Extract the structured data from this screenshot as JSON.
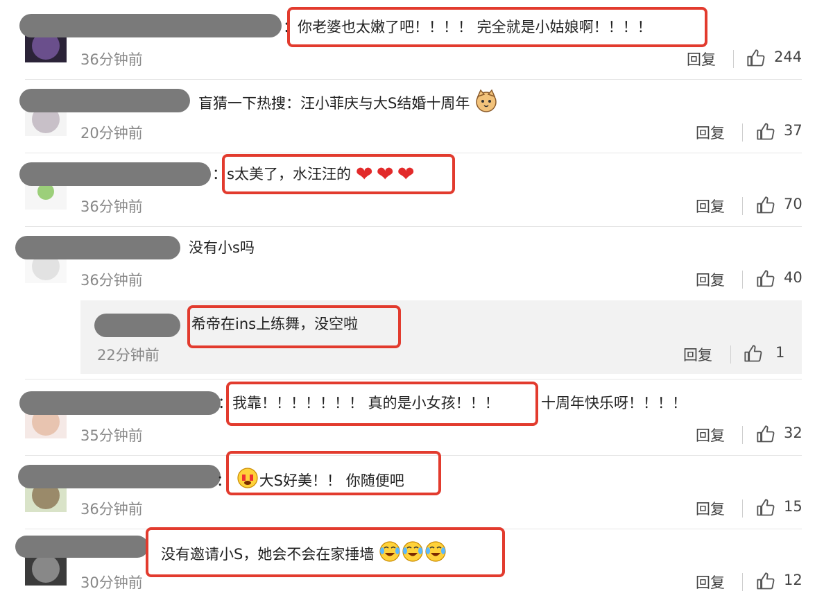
{
  "comments": [
    {
      "text": "：你老婆也太嫩了吧！！！！ 完全就是小姑娘啊！！！！",
      "time": "36分钟前",
      "reply_label": "回复",
      "likes": "244",
      "avatar": "purple-hair-avatar"
    },
    {
      "text": "盲猜一下热搜：汪小菲庆与大S结婚十周年",
      "time": "20分钟前",
      "reply_label": "回复",
      "likes": "37",
      "emoji": "cat-face-emoji"
    },
    {
      "text": "：s太美了，水汪汪的",
      "time": "36分钟前",
      "reply_label": "回复",
      "likes": "70",
      "emoji": "heart-emoji"
    },
    {
      "text": "没有小s吗",
      "time": "36分钟前",
      "reply_label": "回复",
      "likes": "40"
    },
    {
      "text": "希帝在ins上练舞，没空啦",
      "time": "22分钟前",
      "reply_label": "回复",
      "likes": "1"
    },
    {
      "text_a": "：我靠！！！！！！！ 真的是小女孩！！！",
      "text_b": "十周年快乐呀！！！！",
      "time": "35分钟前",
      "reply_label": "回复",
      "likes": "32"
    },
    {
      "text": "大S好美！！ 你随便吧",
      "prefix": "：",
      "time": "36分钟前",
      "reply_label": "回复",
      "likes": "15",
      "emoji": "crying-laughing-emoji"
    },
    {
      "text": "没有邀请小S，她会不会在家捶墙",
      "time": "30分钟前",
      "reply_label": "回复",
      "likes": "12",
      "emoji": "laughing-tears-emoji"
    }
  ],
  "colors": {
    "highlight": "#e23b2e",
    "redaction": "#7a7a7a",
    "time": "#888888",
    "reply_background": "#f2f2f2"
  }
}
